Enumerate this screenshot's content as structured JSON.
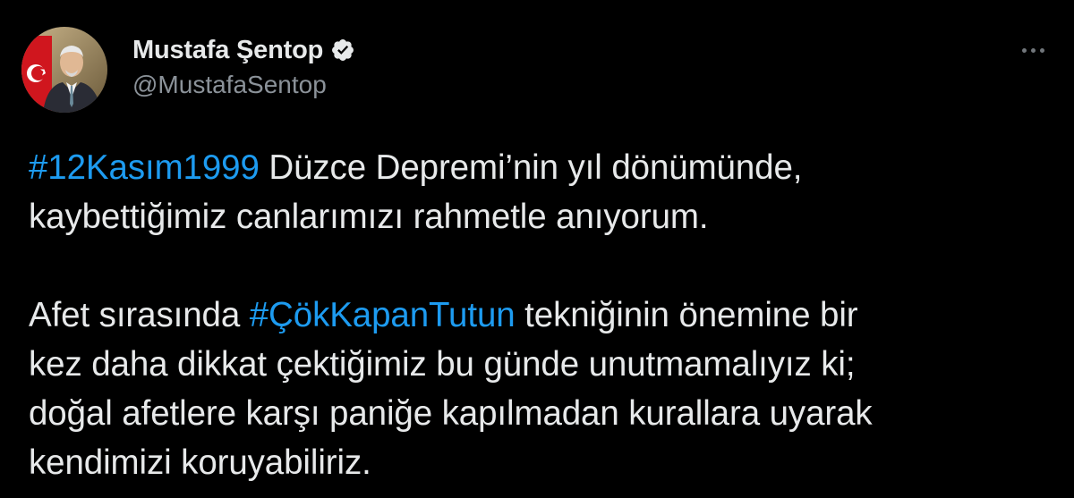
{
  "author": {
    "display_name": "Mustafa Şentop",
    "handle": "@MustafaSentop",
    "verified": true,
    "avatar_icon": "profile-photo"
  },
  "menu": {
    "icon": "more-horizontal-icon"
  },
  "tweet": {
    "paragraph1": {
      "hashtag": "#12Kasım1999",
      "line1_rest": " Düzce Depremi’nin yıl dönümünde,",
      "line2": "kaybettiğimiz canlarımızı rahmetle anıyorum."
    },
    "paragraph2": {
      "line1_before": "Afet sırasında ",
      "hashtag": "#ÇökKapanTutun",
      "line1_after": " tekniğinin önemine bir",
      "line2": "kez daha dikkat çektiğimiz bu günde unutmamalıyız ki;",
      "line3": "doğal afetlere karşı paniğe kapılmadan kurallara uyarak",
      "line4": "kendimizi koruyabiliriz."
    }
  },
  "colors": {
    "background": "#000000",
    "text": "#e7e9ea",
    "secondary": "#8b9299",
    "hashtag": "#1d9bf0"
  }
}
